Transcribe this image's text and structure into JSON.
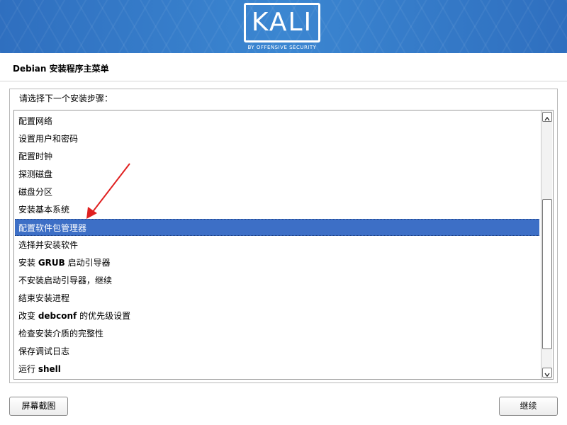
{
  "banner": {
    "logo_text": "KALI",
    "logo_subtext": "BY OFFENSIVE SECURITY",
    "colors": {
      "banner_blue": "#3b86d1",
      "logo": "#ffffff"
    }
  },
  "page_title": "Debian 安装程序主菜单",
  "prompt": "请选择下一个安装步骤：",
  "menu": {
    "selected_index": 6,
    "items": [
      {
        "label": "配置网络"
      },
      {
        "label": "设置用户和密码"
      },
      {
        "label": "配置时钟"
      },
      {
        "label": "探测磁盘"
      },
      {
        "label": "磁盘分区"
      },
      {
        "label": "安装基本系统"
      },
      {
        "label": "配置软件包管理器"
      },
      {
        "label": "选择并安装软件"
      },
      {
        "label_pre": "安装 ",
        "label_bold": "GRUB",
        "label_post": " 启动引导器"
      },
      {
        "label": "不安装启动引导器，继续"
      },
      {
        "label": "结束安装进程"
      },
      {
        "label_pre": "改变 ",
        "label_bold": "debconf",
        "label_post": " 的优先级设置"
      },
      {
        "label": "检查安装介质的完整性"
      },
      {
        "label": "保存调试日志"
      },
      {
        "label_pre": "运行 ",
        "label_bold": "shell",
        "label_post": ""
      }
    ],
    "colors": {
      "selection": "#3d6fc6"
    }
  },
  "buttons": {
    "screenshot": "屏幕截图",
    "continue": "继续"
  },
  "annotation": {
    "color": "#e02020"
  }
}
